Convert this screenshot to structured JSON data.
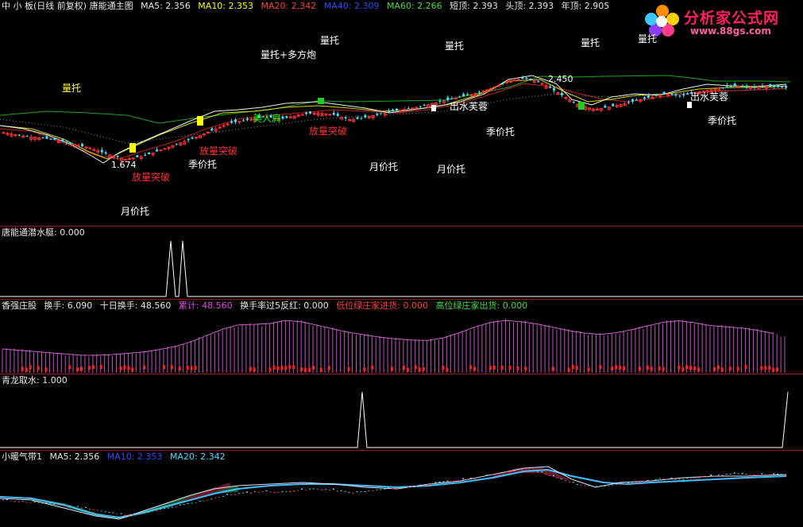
{
  "main_header": {
    "title": "中 小 板(日线 前复权) 唐能通主图",
    "ma5": "MA5: 2.356",
    "ma10": "MA10: 2.353",
    "ma20": "MA20: 2.342",
    "ma40": "MA40: 2.309",
    "ma60": "MA60: 2.266",
    "short_top": "短顶: 2.393",
    "head_top": "头顶: 2.393",
    "year_top": "年顶: 2.905"
  },
  "logo": {
    "name": "分析家公式网",
    "url": "www.88gs.com"
  },
  "annotations": {
    "a1": "量托+多方炮",
    "a2": "量托",
    "a3": "量托",
    "a4": "量托",
    "a5": "量托",
    "a6": "量托",
    "a7": "放量突破",
    "a8": "放量突破",
    "a9": "放量突破",
    "a10": "季价托",
    "a11": "季价托",
    "a12": "季价托",
    "a13": "月价托",
    "a14": "月价托",
    "a15": "月价托",
    "a16": "美人肩",
    "a17": "出水芙蓉",
    "a18": "出水芙蓉",
    "a19": "2.450",
    "a20": "1.674"
  },
  "panel2_header": {
    "title": "唐能通潜水艇",
    "value": ": 0.000"
  },
  "panel3_header": {
    "title": "香强庄股",
    "turnover": "换手: 6.090",
    "ten_day": "十日换手: 48.560",
    "cumulative": "累计: 48.560",
    "rate_red": "换手率过5反红: 0.000",
    "low_green": "低位绿庄家进货: 0.000",
    "high_green": "高位绿庄家出货: 0.000"
  },
  "panel4_header": {
    "title": "青龙取水",
    "value": ": 1.000"
  },
  "panel5_header": {
    "title": "小暖气带1",
    "ma5": "MA5: 2.356",
    "ma10": "MA10: 2.353",
    "ma20": "MA20: 2.342"
  },
  "colors": {
    "up": "#ff3030",
    "down": "#40e0ff",
    "ma5": "#ffffff",
    "ma10": "#ffff00",
    "ma20": "#ff3030",
    "band": "#44dd44",
    "turnover_bar": "#c050c0"
  },
  "chart_data": {
    "type": "line",
    "title": "唐能通主图",
    "price_path": [
      1.93,
      1.9,
      1.88,
      1.86,
      1.82,
      1.78,
      1.72,
      1.674,
      1.7,
      1.76,
      1.82,
      1.88,
      1.95,
      2.02,
      2.05,
      2.08,
      2.06,
      2.1,
      2.12,
      2.1,
      2.05,
      2.08,
      2.12,
      2.15,
      2.18,
      2.22,
      2.26,
      2.3,
      2.35,
      2.42,
      2.45,
      2.4,
      2.3,
      2.2,
      2.15,
      2.18,
      2.22,
      2.26,
      2.3,
      2.28,
      2.32,
      2.35,
      2.38,
      2.36,
      2.37,
      2.36
    ],
    "highs": {
      "year_top": 2.905,
      "short_top": 2.393,
      "head_top": 2.393,
      "marked_high": 2.45,
      "marked_low": 1.674
    },
    "ma": {
      "MA5": 2.356,
      "MA10": 2.353,
      "MA20": 2.342,
      "MA40": 2.309,
      "MA60": 2.266
    },
    "turnover": {
      "latest": 6.09,
      "ten_day": 48.56,
      "cumulative": 48.56
    },
    "signal_submarine": 0.0,
    "signal_dragon": 1.0
  }
}
